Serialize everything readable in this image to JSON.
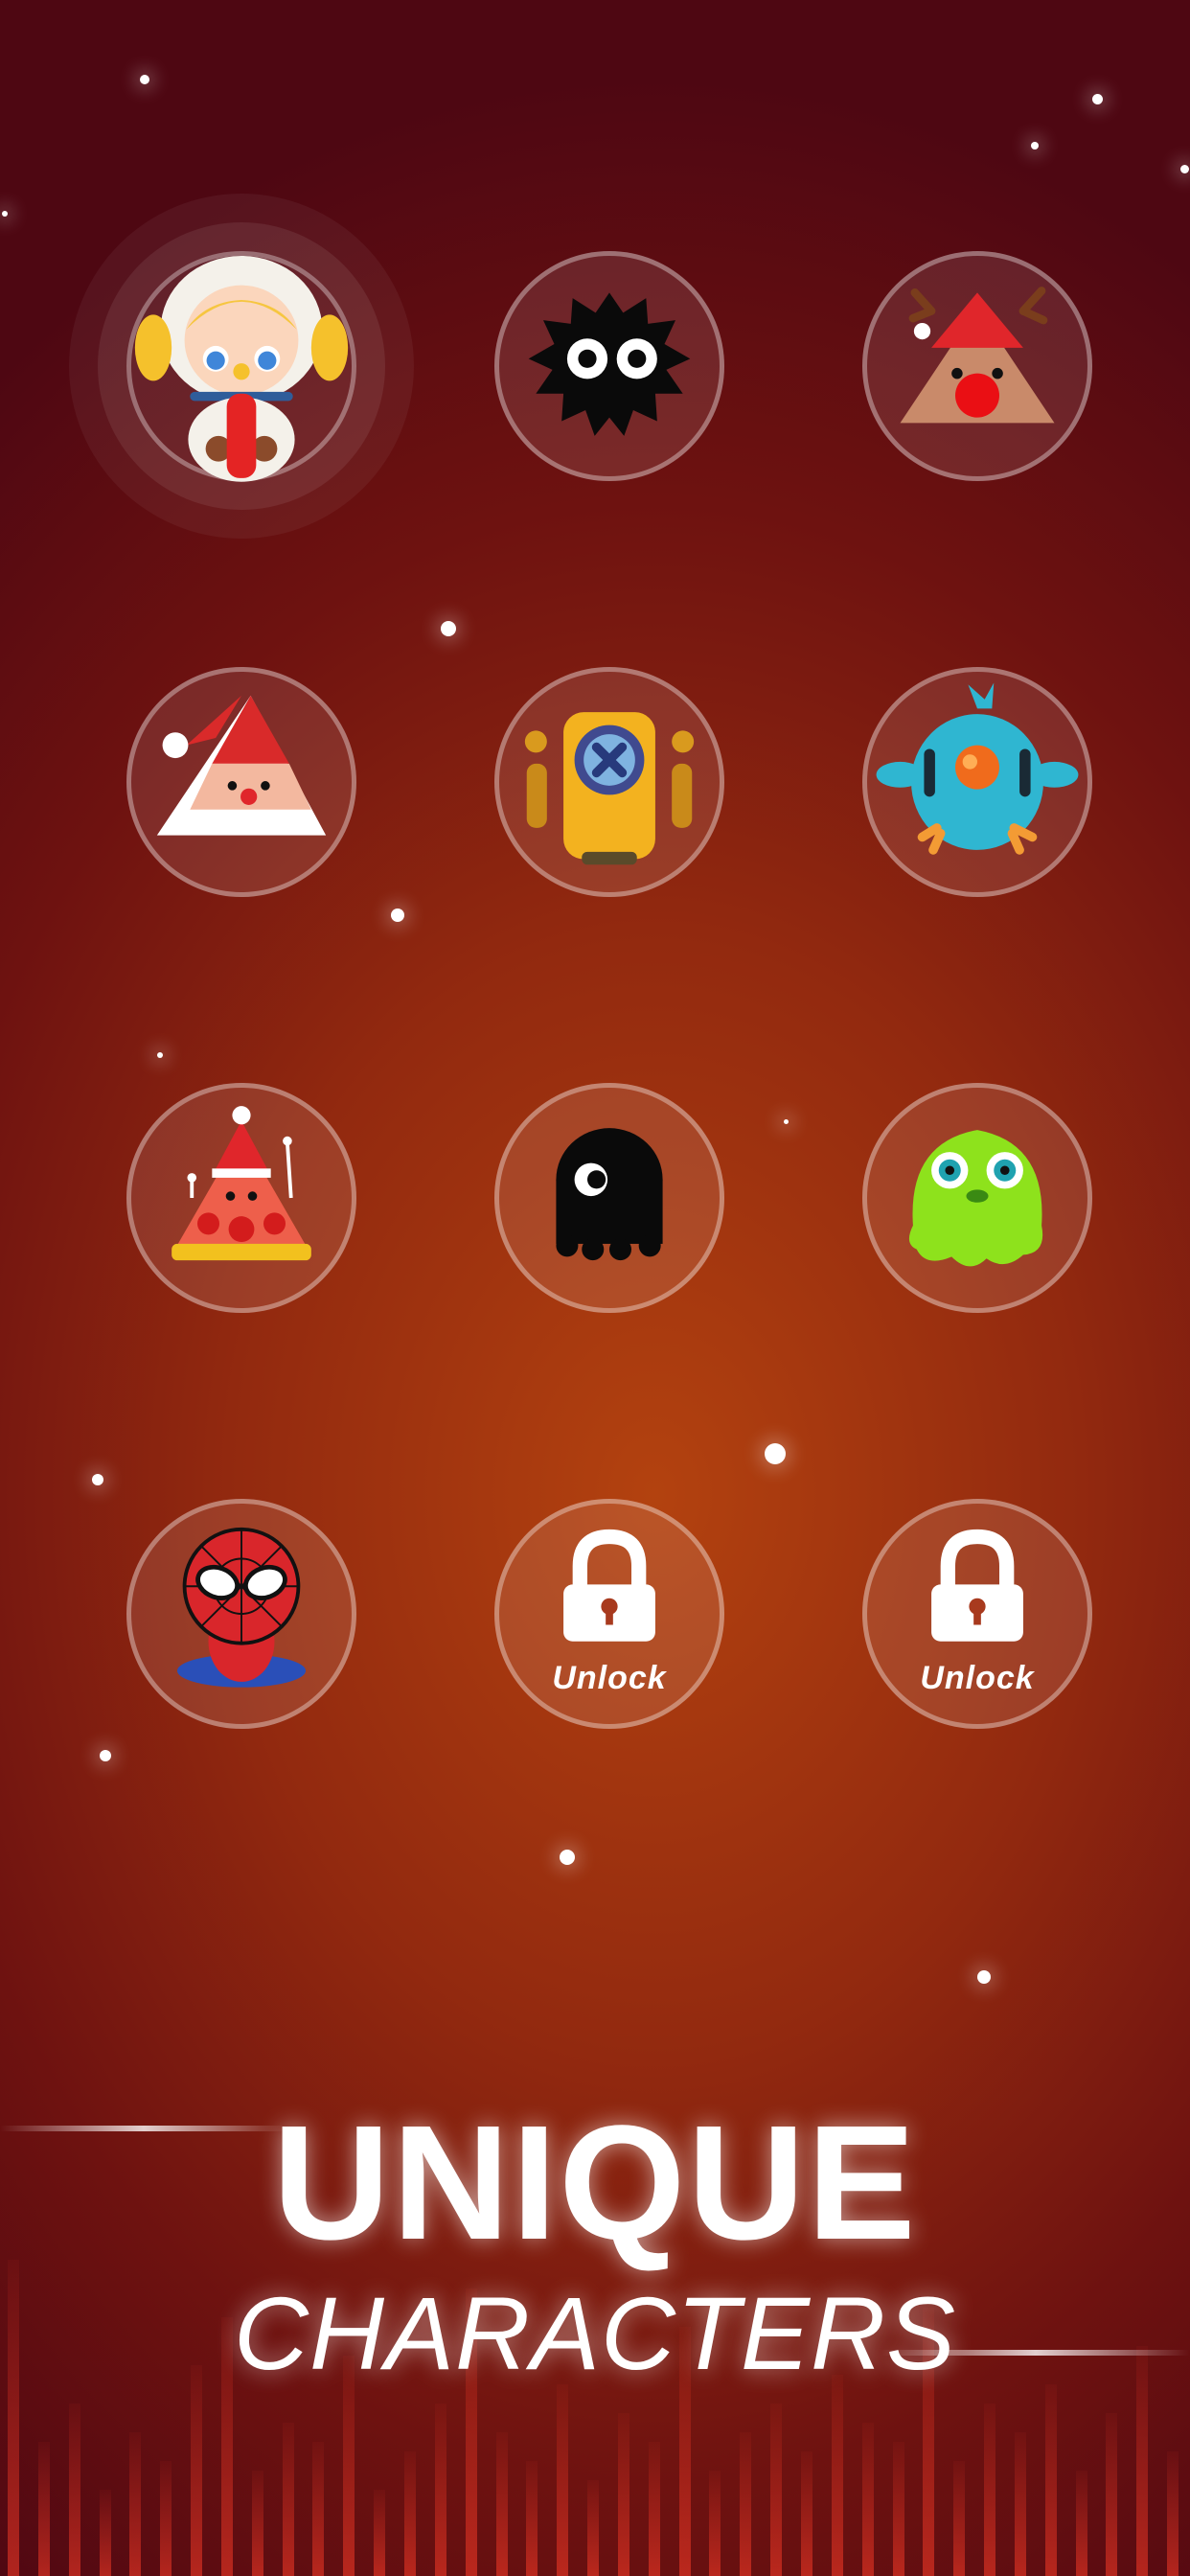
{
  "screen": {
    "title_line1": "UNIQUE",
    "title_line2": "CHARACTERS"
  },
  "characters": [
    {
      "name": "astronaut-girl",
      "state": "selected"
    },
    {
      "name": "soot-sprite",
      "state": "available"
    },
    {
      "name": "reindeer-triangle",
      "state": "available"
    },
    {
      "name": "santa-triangle",
      "state": "available"
    },
    {
      "name": "yellow-robot",
      "state": "available"
    },
    {
      "name": "blue-bird",
      "state": "available"
    },
    {
      "name": "christmas-pizza-slice",
      "state": "available"
    },
    {
      "name": "black-octopus",
      "state": "available"
    },
    {
      "name": "green-slime",
      "state": "available"
    },
    {
      "name": "spiderman",
      "state": "available"
    },
    {
      "name": "locked-slot",
      "state": "locked",
      "label": "Unlock"
    },
    {
      "name": "locked-slot",
      "state": "locked",
      "label": "Unlock"
    }
  ],
  "colors": {
    "background_center": "#b3420f",
    "background_edge": "#4e0712",
    "ring": "#ffffff"
  },
  "icons": [
    "lock-icon"
  ]
}
